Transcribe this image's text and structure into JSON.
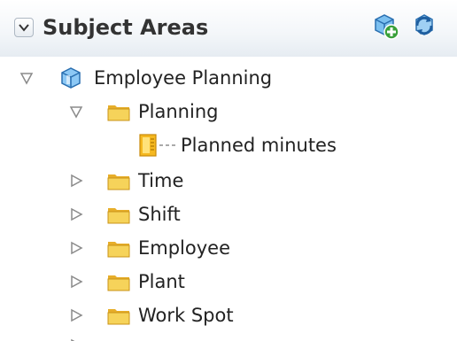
{
  "panel": {
    "title": "Subject Areas",
    "collapse_icon": "chevron-down-icon",
    "tools": [
      {
        "name": "add-subject-area-icon"
      },
      {
        "name": "refresh-icon"
      }
    ]
  },
  "tree": {
    "root": {
      "label": "Employee Planning",
      "icon": "subject-area-cube-icon",
      "expanded": true
    },
    "planning": {
      "label": "Planning",
      "icon": "folder-icon",
      "expanded": true
    },
    "planned_minutes": {
      "label": "Planned minutes",
      "icon": "measure-column-icon"
    },
    "folders": [
      {
        "label": "Time",
        "icon": "folder-icon",
        "expanded": false
      },
      {
        "label": "Shift",
        "icon": "folder-icon",
        "expanded": false
      },
      {
        "label": "Employee",
        "icon": "folder-icon",
        "expanded": false
      },
      {
        "label": "Plant",
        "icon": "folder-icon",
        "expanded": false
      },
      {
        "label": "Work Spot",
        "icon": "folder-icon",
        "expanded": false
      }
    ]
  },
  "colors": {
    "folder": "#f3c63f",
    "cube": "#3f8fd8",
    "text": "#222222",
    "toggle": "#8a8a8a"
  }
}
